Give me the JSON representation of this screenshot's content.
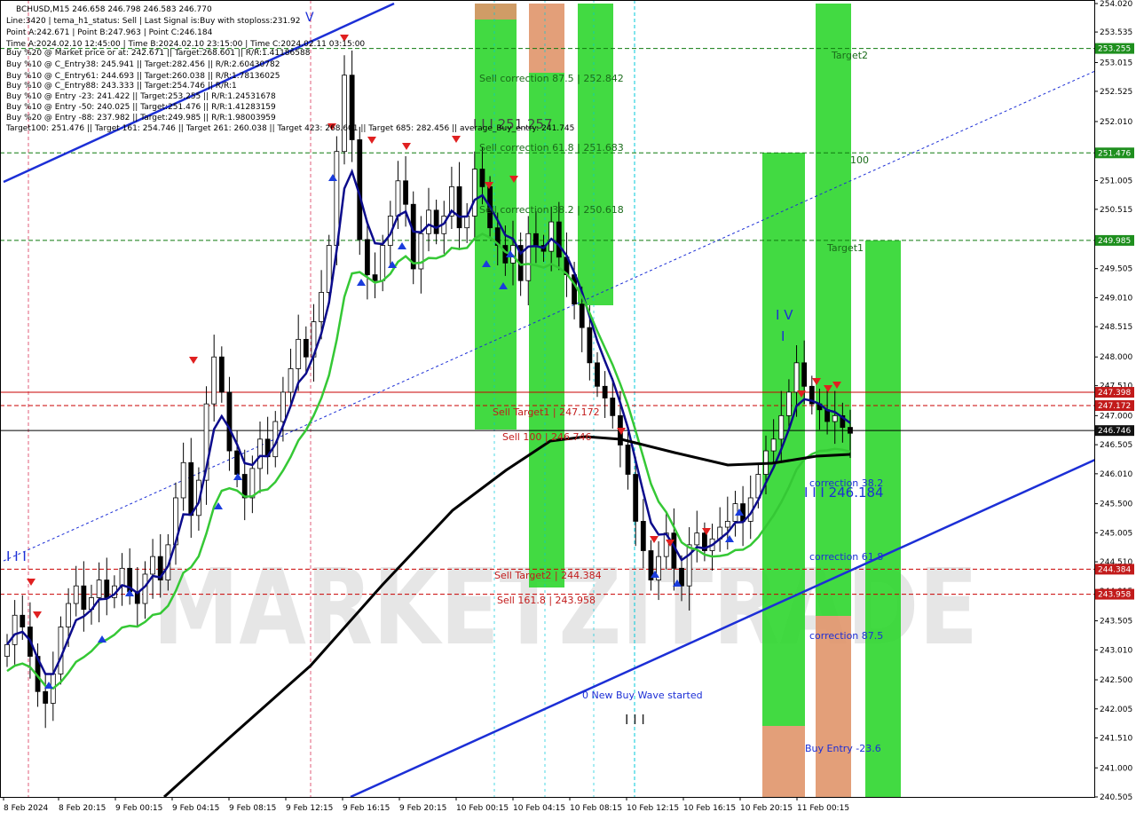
{
  "info_panel": [
    "BCHUSD,M15  246.658 246.798 246.583 246.770",
    "Line:3420 | tema_h1_status: Sell | Last Signal is:Buy with stoploss:231.92",
    "Point A:242.671 | Point B:247.963 | Point C:246.184",
    "Time A:2024.02.10 12:45:00 | Time B:2024.02.10 23:15:00 | Time C:2024.02.11 03:15:00",
    "Buy %20 @ Market price or at: 242.671 || Target:268.601 || R/R:1.41186588",
    "Buy %10 @ C_Entry38: 245.941 || Target:282.456 || R/R:2.60430782",
    "Buy %10 @ C_Entry61: 244.693 || Target:260.038 || R/R:1.78136025",
    "Buy %10 @ C_Entry88: 243.333 || Target:254.746 || R/R:1",
    "Buy %10 @ Entry -23: 241.422 || Target:253.255 || R/R:1.24531678",
    "Buy %10 @ Entry -50: 240.025 || Target:251.476 || R/R:1.41283159",
    "Buy %20 @ Entry -88: 237.982 || Target:249.985 || R/R:1.98003959",
    "Target100: 251.476 || Target 161: 254.746 || Target 261: 260.038 || Target 423: 268.601 || Target 685: 282.456 || average_Buy_entry: 241.745"
  ],
  "watermark": "MARKETZITRADE",
  "colors": {
    "candle_up": "#000000",
    "candle_down": "#000000",
    "line_blue": "#0b0b8c",
    "line_green": "#35c835",
    "line_black": "#000000",
    "trend_blue": "#1c2fd6",
    "zone_green": "#2ed62e",
    "zone_orange": "#e0956a",
    "red_level": "#c90000",
    "green_level": "#0f7a0f",
    "tag_red": "#c21b1b",
    "tag_green": "#1e8f1e",
    "tag_black": "#111111"
  },
  "annotations": {
    "sell_corr_875": "Sell correction 87.5 | 252.842",
    "sell_corr_618": "Sell correction 61.8 | 251.683",
    "sell_corr_382": "Sell correction 38.2 | 250.618",
    "wave_label": "I I I 251.257",
    "sell_target1": "Sell Target1 | 247.172",
    "sell_100": "Sell 100 | 246.746",
    "sell_target2": "Sell Target2 | 244.384",
    "sell_1618": "Sell 161.8 | 243.958",
    "target2": "Target2",
    "target1": "Target1",
    "hundred": "100",
    "iv_label": "I V",
    "i_label": "I",
    "corr_382": "correction 38.2",
    "wave_c": "I I I 246.184",
    "corr_618": "correction 61.8",
    "corr_875": "correction 87.5",
    "buy_entry": "Buy Entry -23.6",
    "new_wave": "0 New Buy Wave started",
    "iii_bottom": "I I I",
    "i_left": "I I I",
    "v_top": "V"
  },
  "chart_data": {
    "type": "candlestick",
    "symbol": "BCHUSD",
    "timeframe": "M15",
    "ylim": [
      240.505,
      254.02
    ],
    "y_ticks": [
      254.02,
      253.535,
      253.015,
      252.525,
      252.01,
      251.5,
      251.005,
      250.515,
      250.0,
      249.505,
      249.01,
      248.515,
      248.0,
      247.51,
      247.0,
      246.505,
      246.01,
      245.5,
      245.005,
      244.51,
      244.015,
      243.505,
      243.01,
      242.5,
      242.005,
      241.51,
      241.0,
      240.505
    ],
    "x_labels": [
      "8 Feb 2024",
      "8 Feb 20:15",
      "9 Feb 00:15",
      "9 Feb 04:15",
      "9 Feb 08:15",
      "9 Feb 12:15",
      "9 Feb 16:15",
      "9 Feb 20:15",
      "10 Feb 00:15",
      "10 Feb 04:15",
      "10 Feb 08:15",
      "10 Feb 12:15",
      "10 Feb 16:15",
      "10 Feb 20:15",
      "11 Feb 00:15"
    ],
    "levels": [
      {
        "price": 253.255,
        "kind": "green"
      },
      {
        "price": 251.476,
        "kind": "green"
      },
      {
        "price": 249.985,
        "kind": "green"
      },
      {
        "price": 247.398,
        "kind": "red"
      },
      {
        "price": 247.172,
        "kind": "red"
      },
      {
        "price": 246.746,
        "kind": "black"
      },
      {
        "price": 244.384,
        "kind": "red"
      },
      {
        "price": 243.958,
        "kind": "red"
      }
    ],
    "price_tags": [
      "253.255",
      "251.476",
      "249.985",
      "247.398",
      "247.172",
      "246.746",
      "244.384",
      "243.958"
    ],
    "close_series": [
      243.1,
      243.6,
      243.4,
      242.9,
      242.3,
      242.1,
      242.6,
      243.4,
      243.8,
      244.1,
      243.7,
      243.9,
      244.2,
      243.9,
      244.1,
      244.4,
      244.0,
      243.8,
      244.3,
      244.6,
      244.2,
      244.8,
      245.6,
      246.2,
      245.3,
      245.9,
      247.2,
      248.0,
      247.4,
      246.4,
      246.0,
      245.6,
      246.1,
      246.6,
      246.3,
      246.9,
      247.4,
      247.8,
      248.3,
      248.0,
      248.6,
      249.1,
      249.9,
      251.5,
      252.8,
      251.7,
      250.0,
      249.4,
      249.3,
      249.9,
      250.4,
      251.0,
      250.6,
      249.5,
      250.1,
      250.5,
      250.1,
      250.4,
      250.9,
      250.2,
      250.4,
      251.2,
      250.9,
      250.2,
      249.9,
      249.6,
      249.9,
      249.3,
      250.1,
      249.9,
      249.8,
      250.3,
      249.7,
      249.4,
      248.9,
      248.5,
      247.9,
      247.5,
      247.3,
      247.0,
      246.5,
      246.0,
      245.2,
      244.7,
      244.2,
      244.6,
      245.0,
      244.4,
      244.1,
      244.8,
      245.0,
      244.7,
      244.9,
      245.1,
      245.2,
      245.5,
      245.2,
      245.6,
      246.0,
      246.4,
      246.6,
      247.0,
      247.4,
      247.9,
      247.5,
      247.2,
      247.1,
      246.9,
      247.0,
      246.8,
      246.7
    ]
  }
}
